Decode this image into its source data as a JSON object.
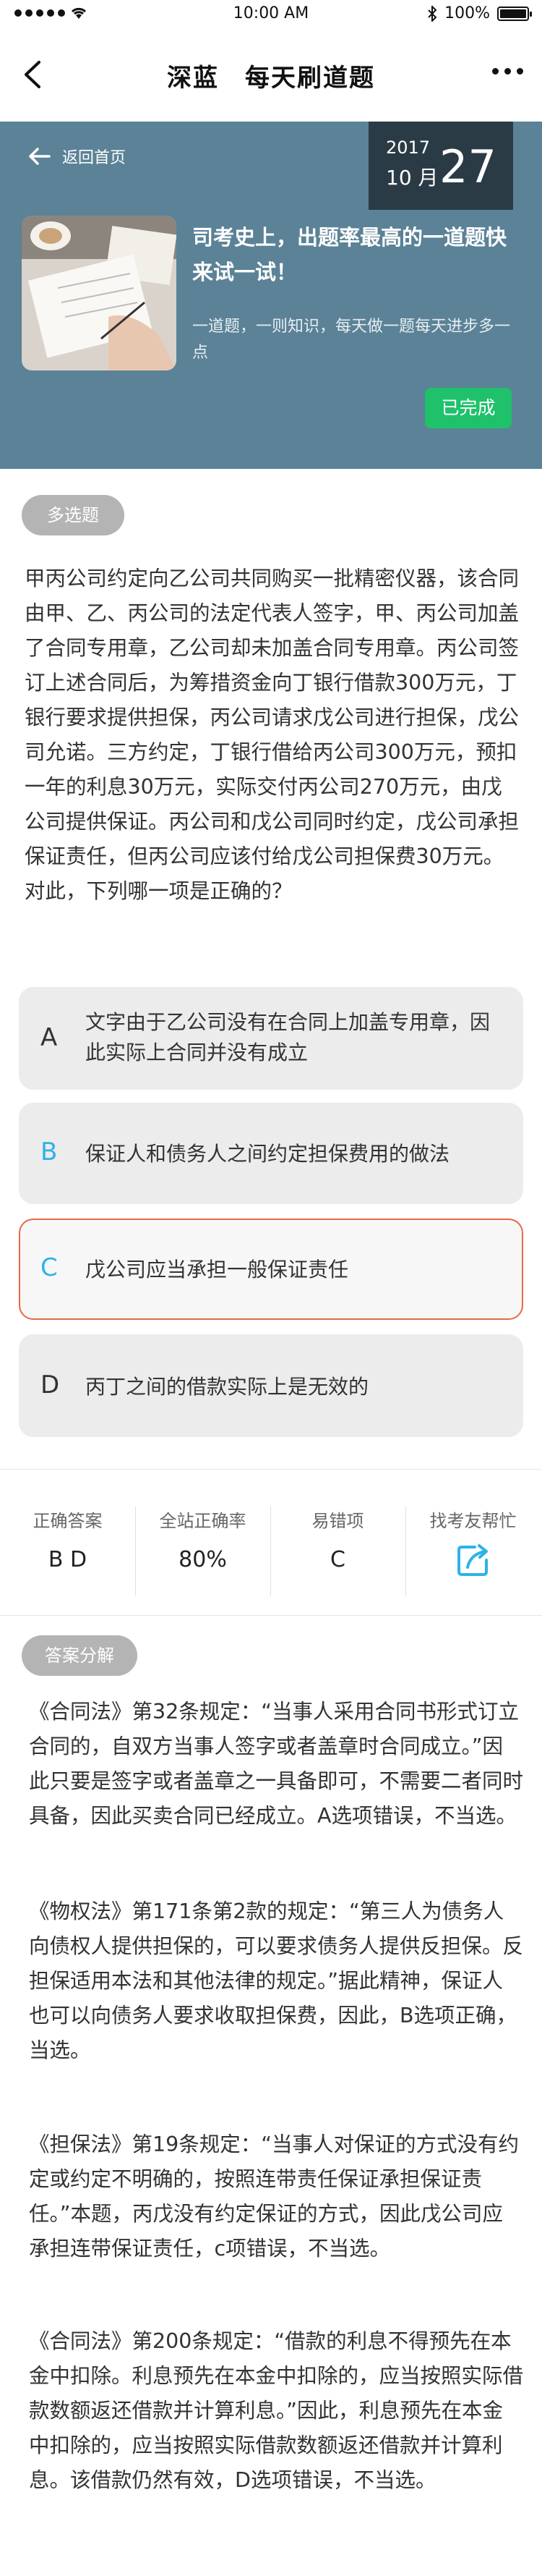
{
  "status_bar": {
    "time": "10:00 AM",
    "battery": "100%",
    "battery_level": 1.0
  },
  "nav": {
    "title": "深蓝　每天刷道题"
  },
  "header": {
    "back_label": "返回首页",
    "date": {
      "year": "2017",
      "month": "10 月",
      "day": "27"
    },
    "title": "司考史上，出题率最高的一道题快来试一试！",
    "subtitle": "一道题，一则知识，每天做一题每天进步多一点",
    "status_badge": "已完成",
    "colors": {
      "header_bg": "#5b8297",
      "date_bg": "#2b3b46",
      "badge": "#1fc26b"
    }
  },
  "question": {
    "type_tag": "多选题",
    "text": "甲丙公司约定向乙公司共同购买一批精密仪器，该合同由甲、乙、丙公司的法定代表人签字，甲、丙公司加盖了合同专用章，乙公司却未加盖合同专用章。丙公司签订上述合同后，为筹措资金向丁银行借款300万元，丁银行要求提供担保，丙公司请求戊公司进行担保，戊公司允诺。三方约定，丁银行借给丙公司300万元，预扣一年的利息30万元，实际交付丙公司270万元，由戊公司提供保证。丙公司和戊公司同时约定，戊公司承担保证责任，但丙公司应该付给戊公司担保费30万元。对此，下列哪一项是正确的？",
    "options": [
      {
        "letter": "A",
        "text": "文字由于乙公司没有在合同上加盖专用章，因此实际上合同并没有成立"
      },
      {
        "letter": "B",
        "text": "保证人和债务人之间约定担保费用的做法"
      },
      {
        "letter": "C",
        "text": "戊公司应当承担一般保证责任"
      },
      {
        "letter": "D",
        "text": "丙丁之间的借款实际上是无效的"
      }
    ],
    "colors": {
      "selected_letter": "#2cb3e6",
      "selected_border": "#e36a4b"
    }
  },
  "stats": [
    {
      "label": "正确答案",
      "value": "B D"
    },
    {
      "label": "全站正确率",
      "value": "80%"
    },
    {
      "label": "易错项",
      "value": "C"
    },
    {
      "label": "找考友帮忙",
      "icon": "share-icon"
    }
  ],
  "analysis": {
    "tag": "答案分解",
    "paragraphs": [
      "《合同法》第32条规定：“当事人采用合同书形式订立合同的，自双方当事人签字或者盖章时合同成立。”因此只要是签字或者盖章之一具备即可，不需要二者同时具备，因此买卖合同已经成立。A选项错误，不当选。",
      "《物权法》第171条第2款的规定：“第三人为债务人向债权人提供担保的，可以要求债务人提供反担保。反担保适用本法和其他法律的规定。”据此精神，保证人也可以向债务人要求收取担保费，因此，B选项正确，当选。",
      "《担保法》第19条规定：“当事人对保证的方式没有约定或约定不明确的，按照连带责任保证承担保证责任。”本题，丙戊没有约定保证的方式，因此戊公司应承担连带保证责任，c项错误，不当选。",
      "《合同法》第200条规定：“借款的利息不得预先在本金中扣除。利息预先在本金中扣除的，应当按照实际借款数额返还借款并计算利息。”因此，利息预先在本金中扣除的，应当按照实际借款数额返还借款并计算利息。该借款仍然有效，D选项错误，不当选。"
    ]
  }
}
